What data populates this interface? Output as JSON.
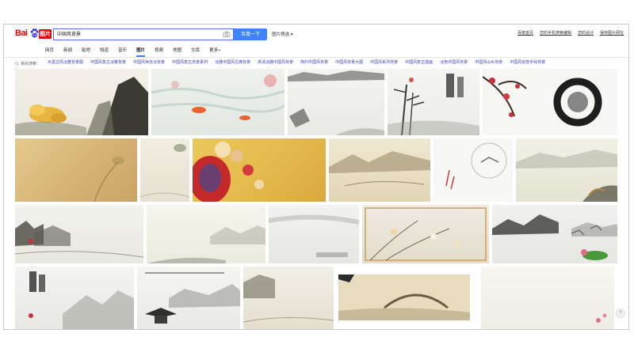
{
  "header": {
    "logo_bai": "Bai",
    "logo_tupian": "图片",
    "search_value": "中国风背景",
    "search_button": "百度一下",
    "filter_label": "图片筛选",
    "links": [
      "百度首页",
      "您的手机搜索编辑",
      "您的设计",
      "保存图片网址"
    ]
  },
  "nav": {
    "tabs": [
      "网页",
      "新闻",
      "贴吧",
      "知道",
      "音乐",
      "图片",
      "视频",
      "地图",
      "文库",
      "更多»"
    ],
    "active": "图片"
  },
  "related": {
    "label": "相关搜索：",
    "items": [
      "水墨古风淡雅背景图",
      "中国风复古淡雅背景",
      "中国风休去淡背景",
      "中国风复古背景素材",
      "淡雅中国风古典背景",
      "高清淡雅中国风背景",
      "简约中国风背景",
      "中国风背景大图",
      "中国风系列背景",
      "中国风复古插画",
      "淡色中国风背景",
      "中国风山水背景",
      "中国风创意手绘背景"
    ]
  },
  "colors": {
    "accent": "#3b85f8",
    "brand_red": "#e10601",
    "link": "#3a3fb5"
  },
  "icons": {
    "camera": "camera-icon",
    "scroll_top": "scroll-top-icon",
    "logo_paw": "paw-icon"
  }
}
